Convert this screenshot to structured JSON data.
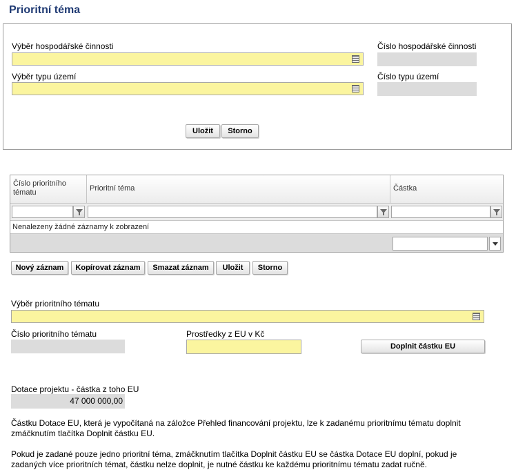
{
  "title": "Prioritní téma",
  "panel": {
    "activity_select_label": "Výběr hospodářské činnosti",
    "activity_number_label": "Číslo hospodářské činnosti",
    "territory_select_label": "Výběr typu území",
    "territory_number_label": "Číslo typu území",
    "save_label": "Uložit",
    "cancel_label": "Storno"
  },
  "grid": {
    "columns": [
      "Číslo prioritního tématu",
      "Prioritní téma",
      "Částka"
    ],
    "empty_message": "Nenalezeny žádné záznamy k zobrazení"
  },
  "toolbar": {
    "new_label": "Nový záznam",
    "copy_label": "Kopírovat záznam",
    "delete_label": "Smazat záznam",
    "save_label": "Uložit",
    "cancel_label": "Storno"
  },
  "detail": {
    "topic_select_label": "Výběr prioritního tématu",
    "topic_number_label": "Číslo prioritního tématu",
    "eu_funds_label": "Prostředky z EU v Kč",
    "fill_button_label": "Doplnit částku EU",
    "subsidy_label": "Dotace projektu - částka z toho EU",
    "subsidy_value": "47 000 000,00"
  },
  "notes": {
    "p1": "Částku Dotace EU, která je vypočítaná na záložce Přehled financování projektu, lze k zadanému prioritnímu tématu doplnit zmáčknutím tlačítka Doplnit částku EU.",
    "p2": "Pokud je zadané pouze jedno prioritní téma, zmáčknutím tlačítka Doplnit částku EU se částka Dotace EU doplní, pokud je zadaných více prioritních témat, částku nelze doplnit, je nutné částku ke každému prioritnímu tématu zadat ručně."
  }
}
